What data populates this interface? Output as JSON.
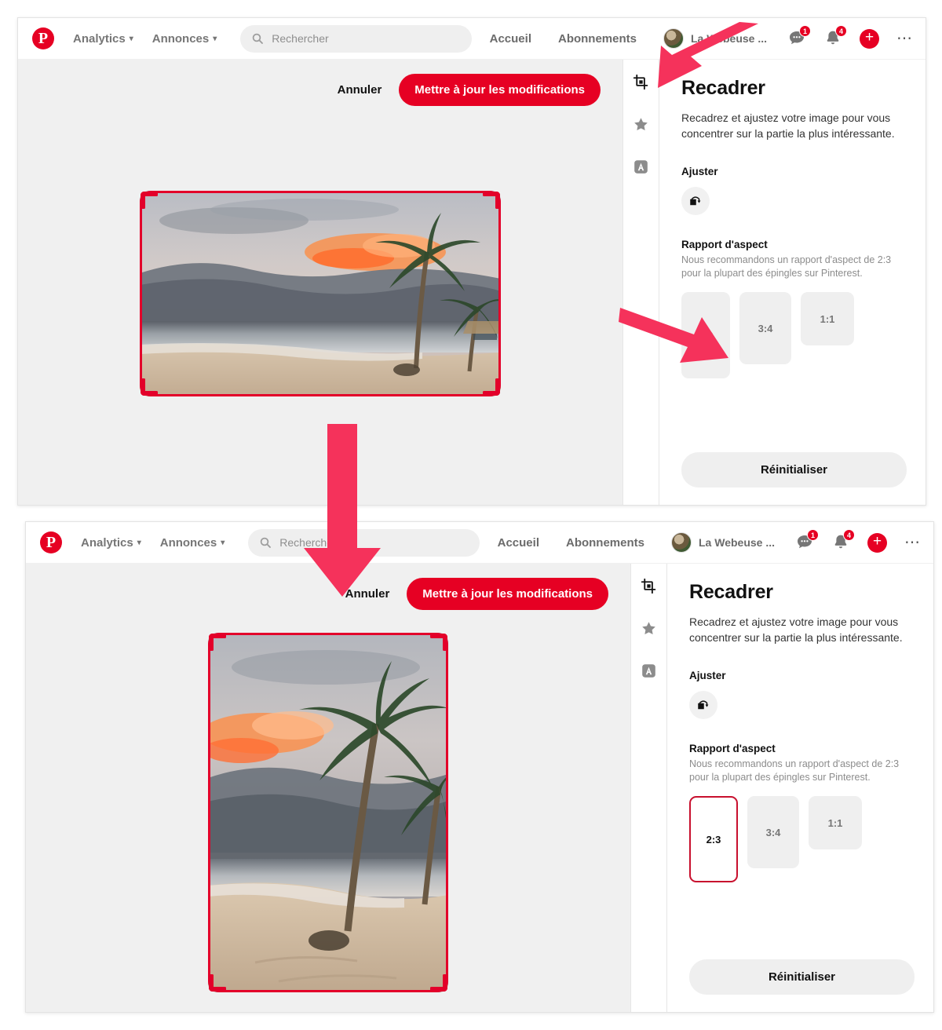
{
  "accent": {
    "pinterest_red": "#e60023",
    "annotation_pink": "#f5325b",
    "crop_red": "#e3002a"
  },
  "navbar": {
    "logo": "pinterest-logo",
    "menu": [
      {
        "label": "Analytics",
        "caret": "⌄"
      },
      {
        "label": "Annonces",
        "caret": "⌄"
      }
    ],
    "search": {
      "placeholder": "Rechercher",
      "value": "",
      "icon": "search-icon"
    },
    "links": [
      {
        "label": "Accueil"
      },
      {
        "label": "Abonnements"
      }
    ],
    "account": {
      "name": "La Webeuse ...",
      "avatar": "user-avatar"
    },
    "icons": [
      {
        "name": "messages-icon",
        "badge": "1"
      },
      {
        "name": "notifications-icon",
        "badge": "4"
      },
      {
        "name": "create-pin-icon",
        "badge": ""
      },
      {
        "name": "more-options-icon",
        "badge": ""
      }
    ]
  },
  "editor": {
    "cancel_label": "Annuler",
    "save_label": "Mettre à jour les modifications",
    "image_alt": "beach-sunset-palm-trees"
  },
  "rail": [
    {
      "name": "crop-tool",
      "label": "crop-icon",
      "active": true
    },
    {
      "name": "highlight-tool",
      "label": "star-icon",
      "active": false
    },
    {
      "name": "text-tool",
      "label": "text-a-icon",
      "active": false
    }
  ],
  "sidepanel": {
    "title": "Recadrer",
    "description": "Recadrez et ajustez votre image pour vous concentrer sur la partie la plus intéressante.",
    "fit_label": "Ajuster",
    "fit_icon": "rotate-fit-icon",
    "ratio_label": "Rapport d'aspect",
    "ratio_desc": "Nous recommandons un rapport d'aspect de 2:3 pour la plupart des épingles sur Pinterest.",
    "ratios": [
      {
        "label": "2:3",
        "selected_before": false,
        "selected_after": true
      },
      {
        "label": "3:4",
        "selected_before": false,
        "selected_after": false
      },
      {
        "label": "1:1",
        "selected_before": false,
        "selected_after": false
      }
    ],
    "reset_label": "Réinitialiser"
  },
  "annotations": [
    {
      "name": "arrow-to-crop-tool",
      "direction": "down-left"
    },
    {
      "name": "arrow-to-ratio-2-3",
      "direction": "down-right"
    },
    {
      "name": "arrow-step-flow",
      "direction": "down"
    }
  ]
}
